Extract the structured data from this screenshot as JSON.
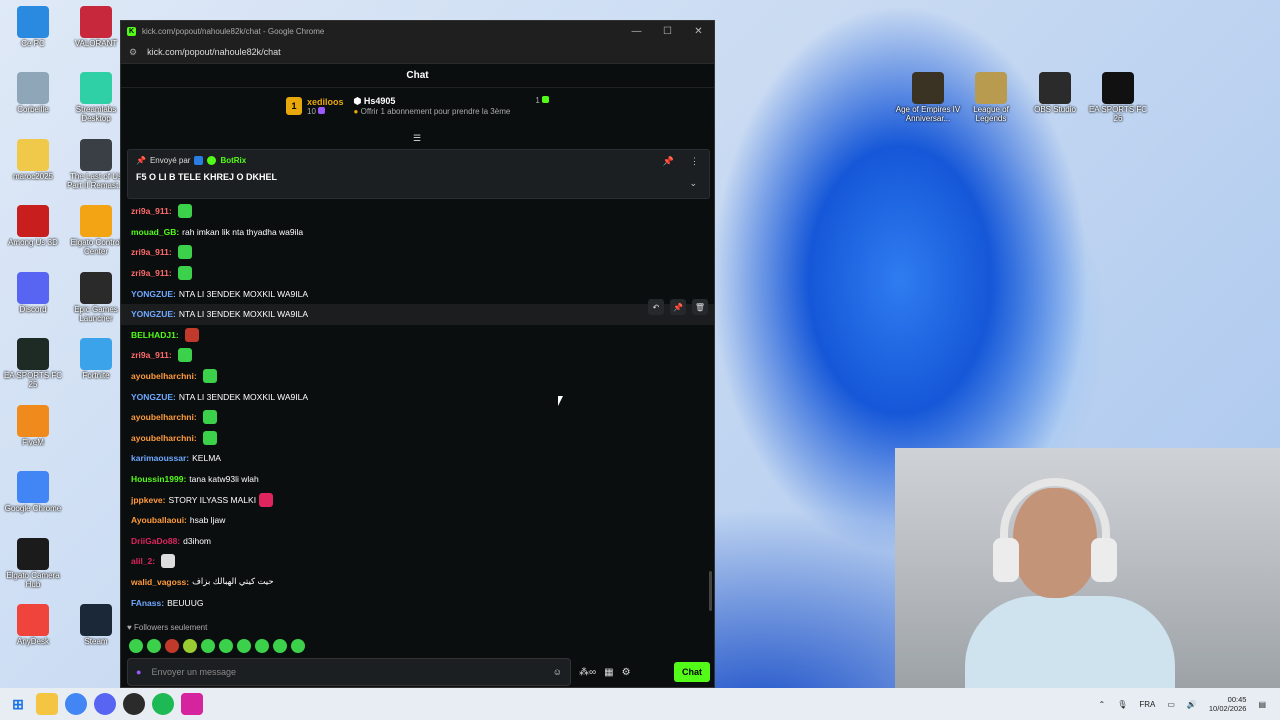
{
  "desktop_left": [
    {
      "label": "Ce PC",
      "color": "#2a8ae0"
    },
    {
      "label": "VALORANT",
      "color": "#c8283c"
    },
    {
      "label": "Corbeille",
      "color": "#8fa5b8"
    },
    {
      "label": "Streamlabs Desktop",
      "color": "#2fd0a6"
    },
    {
      "label": "maroc2025",
      "color": "#f0c94a"
    },
    {
      "label": "The Last of Us Part II Remast...",
      "color": "#3a3f46"
    },
    {
      "label": "Among Us 3D",
      "color": "#c81e1e"
    },
    {
      "label": "Elgato Control Center",
      "color": "#f2a414"
    },
    {
      "label": "Discord",
      "color": "#5865f2"
    },
    {
      "label": "Epic Games Launcher",
      "color": "#2a2a2a"
    },
    {
      "label": "EA SPORTS FC 25",
      "color": "#1e2a24"
    },
    {
      "label": "Fortnite",
      "color": "#3aa3ea"
    },
    {
      "label": "FiveM",
      "color": "#f08a1c"
    },
    {
      "label": "Google Chrome",
      "color": "#4285f4"
    },
    {
      "label": "Elgato Camera Hub",
      "color": "#1b1b1b"
    },
    {
      "label": "AnyDesk",
      "color": "#ef443b"
    },
    {
      "label": "Steam",
      "color": "#1b2838"
    }
  ],
  "desktop_right": [
    {
      "label": "Age of Empires IV Anniversar...",
      "color": "#3a3223"
    },
    {
      "label": "League of Legends",
      "color": "#b89b4e"
    },
    {
      "label": "OBS Studio",
      "color": "#2b2b2b"
    },
    {
      "label": "EA SPORTS FC 26",
      "color": "#111111"
    }
  ],
  "browser": {
    "title": "kick.com/popout/nahoule82k/chat - Google Chrome",
    "url": "kick.com/popout/nahoule82k/chat"
  },
  "chat": {
    "header": "Chat",
    "gifter1": {
      "rank": "1",
      "name": "xediloos",
      "count": "10"
    },
    "gifter2": {
      "name": "Hs4905",
      "sub": "Offrir 1 abonnement pour prendre la 3ème",
      "count": "1"
    },
    "pinned": {
      "sent_by": "Envoyé par",
      "bot": "BotRix",
      "message": "F5 O LI B TELE KHREJ O DKHEL"
    },
    "messages": [
      {
        "user": "zri9a_911",
        "color": "#ff6b6b",
        "text": "",
        "emote": "#3bd14a"
      },
      {
        "user": "mouad_GB",
        "color": "#53fc18",
        "text": "rah imkan lik nta thyadha wa9ila",
        "emote": ""
      },
      {
        "user": "zri9a_911",
        "color": "#ff6b6b",
        "text": "",
        "emote": "#3bd14a"
      },
      {
        "user": "zri9a_911",
        "color": "#ff6b6b",
        "text": "",
        "emote": "#3bd14a"
      },
      {
        "user": "YONGZUE",
        "color": "#6fa8ff",
        "text": "NTA LI 3ENDEK MOXKIL WA9ILA",
        "emote": ""
      },
      {
        "user": "YONGZUE",
        "color": "#6fa8ff",
        "text": "NTA LI 3ENDEK MOXKIL WA9ILA",
        "emote": ""
      },
      {
        "user": "BELHADJ1",
        "color": "#53fc18",
        "text": "",
        "emote": "#c0392b"
      },
      {
        "user": "zri9a_911",
        "color": "#ff6b6b",
        "text": "",
        "emote": "#3bd14a"
      },
      {
        "user": "ayoubelharchni",
        "color": "#ff9b3b",
        "text": "",
        "emote": "#3bd14a"
      },
      {
        "user": "YONGZUE",
        "color": "#6fa8ff",
        "text": "NTA LI 3ENDEK MOXKIL WA9ILA",
        "emote": ""
      },
      {
        "user": "ayoubelharchni",
        "color": "#ff9b3b",
        "text": "",
        "emote": "#3bd14a"
      },
      {
        "user": "ayoubelharchni",
        "color": "#ff9b3b",
        "text": "",
        "emote": "#3bd14a"
      },
      {
        "user": "karimaoussar",
        "color": "#6fa8ff",
        "text": "KELMA",
        "emote": ""
      },
      {
        "user": "Houssin1999",
        "color": "#53fc18",
        "text": "tana katw93li wlah",
        "emote": ""
      },
      {
        "user": "jppkeve",
        "color": "#ff9b3b",
        "text": "STORY ILYASS MALKI",
        "emote": "#e0245e"
      },
      {
        "user": "Ayouballaoui",
        "color": "#ff9b3b",
        "text": "hsab ljaw",
        "emote": ""
      },
      {
        "user": "DriiGaDo88",
        "color": "#e0245e",
        "text": "d3ihom",
        "emote": ""
      },
      {
        "user": "alil_2",
        "color": "#e0245e",
        "text": "",
        "emote": "#dddddd"
      },
      {
        "user": "walid_vagoss",
        "color": "#ff9b3b",
        "text": "حيت كيتي الهبالك بزاف",
        "emote": ""
      },
      {
        "user": "FAnass",
        "color": "#6fa8ff",
        "text": "BEUUUG",
        "emote": ""
      }
    ],
    "followers": "Followers seulement",
    "input_placeholder": "Envoyer un message",
    "send_label": "Chat"
  },
  "taskbar": {
    "lang": "FRA",
    "time": "00:45",
    "date": "10/02/2026"
  }
}
